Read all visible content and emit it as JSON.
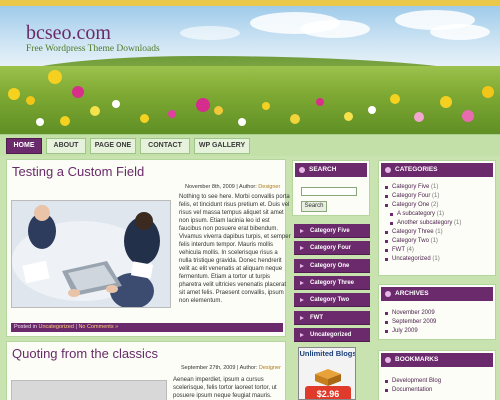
{
  "site": {
    "title": "bcseo.com",
    "tagline": "Free Wordpress Theme Downloads"
  },
  "nav": {
    "items": [
      "HOME",
      "ABOUT",
      "PAGE ONE",
      "CONTACT",
      "WP GALLERY"
    ],
    "active": "HOME"
  },
  "posts": [
    {
      "title": "Testing a Custom Field",
      "date": "November 8th, 2009",
      "author_label": "| Author:",
      "author": "Designer",
      "text": "Nothing to see here. Morbi convallis porta felis, et tincidunt risus pretium et. Duis vel risus vel massa tempus aliquet sit amet non ipsum. Etiam lacinia leo id est faucibus non posuere erat bibendum. Vivamus viverra dapibus turpis, et semper felis interdum tempor. Mauris mollis vehicula mollis. In scelerisque risus a nulla tristique gravida. Donec hendrerit velit ac elit venenatis at aliquam neque fermentum. Etiam a tortor ut turpis pharetra velit ultricies venenatis placerat sit amet felis. Praesent convallis, ipsum non elementum.",
      "footer_prefix": "Posted in",
      "footer_category": "Uncategorized",
      "footer_comments": "No Comments »"
    },
    {
      "title": "Quoting from the classics",
      "date": "September 27th, 2009",
      "author_label": "| Author:",
      "author": "Designer",
      "text": "Aenean imperdiet, ipsum a cursus scelerisque, felis tortor laoreet tortor, ut posuere ipsum neque feugiat mauris."
    }
  ],
  "search": {
    "heading": "SEARCH",
    "button_label": "Search",
    "value": ""
  },
  "category_buttons": [
    "Category Five",
    "Category Four",
    "Category One",
    "Category Three",
    "Category Two",
    "FWT",
    "Uncategorized"
  ],
  "ad": {
    "title": "Unlimited Blogs",
    "price": "$2.96"
  },
  "categories": {
    "heading": "CATEGORIES",
    "items": [
      {
        "label": "Category Five",
        "count": "(1)",
        "sub": false
      },
      {
        "label": "Category Four",
        "count": "(1)",
        "sub": false
      },
      {
        "label": "Category One",
        "count": "(2)",
        "sub": false
      },
      {
        "label": "A subcategory",
        "count": "(1)",
        "sub": true
      },
      {
        "label": "Another subcategory",
        "count": "(1)",
        "sub": true
      },
      {
        "label": "Category Three",
        "count": "(1)",
        "sub": false
      },
      {
        "label": "Category Two",
        "count": "(1)",
        "sub": false
      },
      {
        "label": "FWT",
        "count": "(4)",
        "sub": false
      },
      {
        "label": "Uncategorized",
        "count": "(1)",
        "sub": false
      }
    ]
  },
  "archives": {
    "heading": "ARCHIVES",
    "items": [
      "November 2009",
      "September 2009",
      "July 2009"
    ]
  },
  "bookmarks": {
    "heading": "BOOKMARKS",
    "items": [
      "Development Blog",
      "Documentation"
    ]
  },
  "colors": {
    "accent_purple": "#6b2a6b",
    "title_purple": "#6a2a6a",
    "meadow_green": "#7faa33",
    "background_green": "#c9e3b0"
  }
}
